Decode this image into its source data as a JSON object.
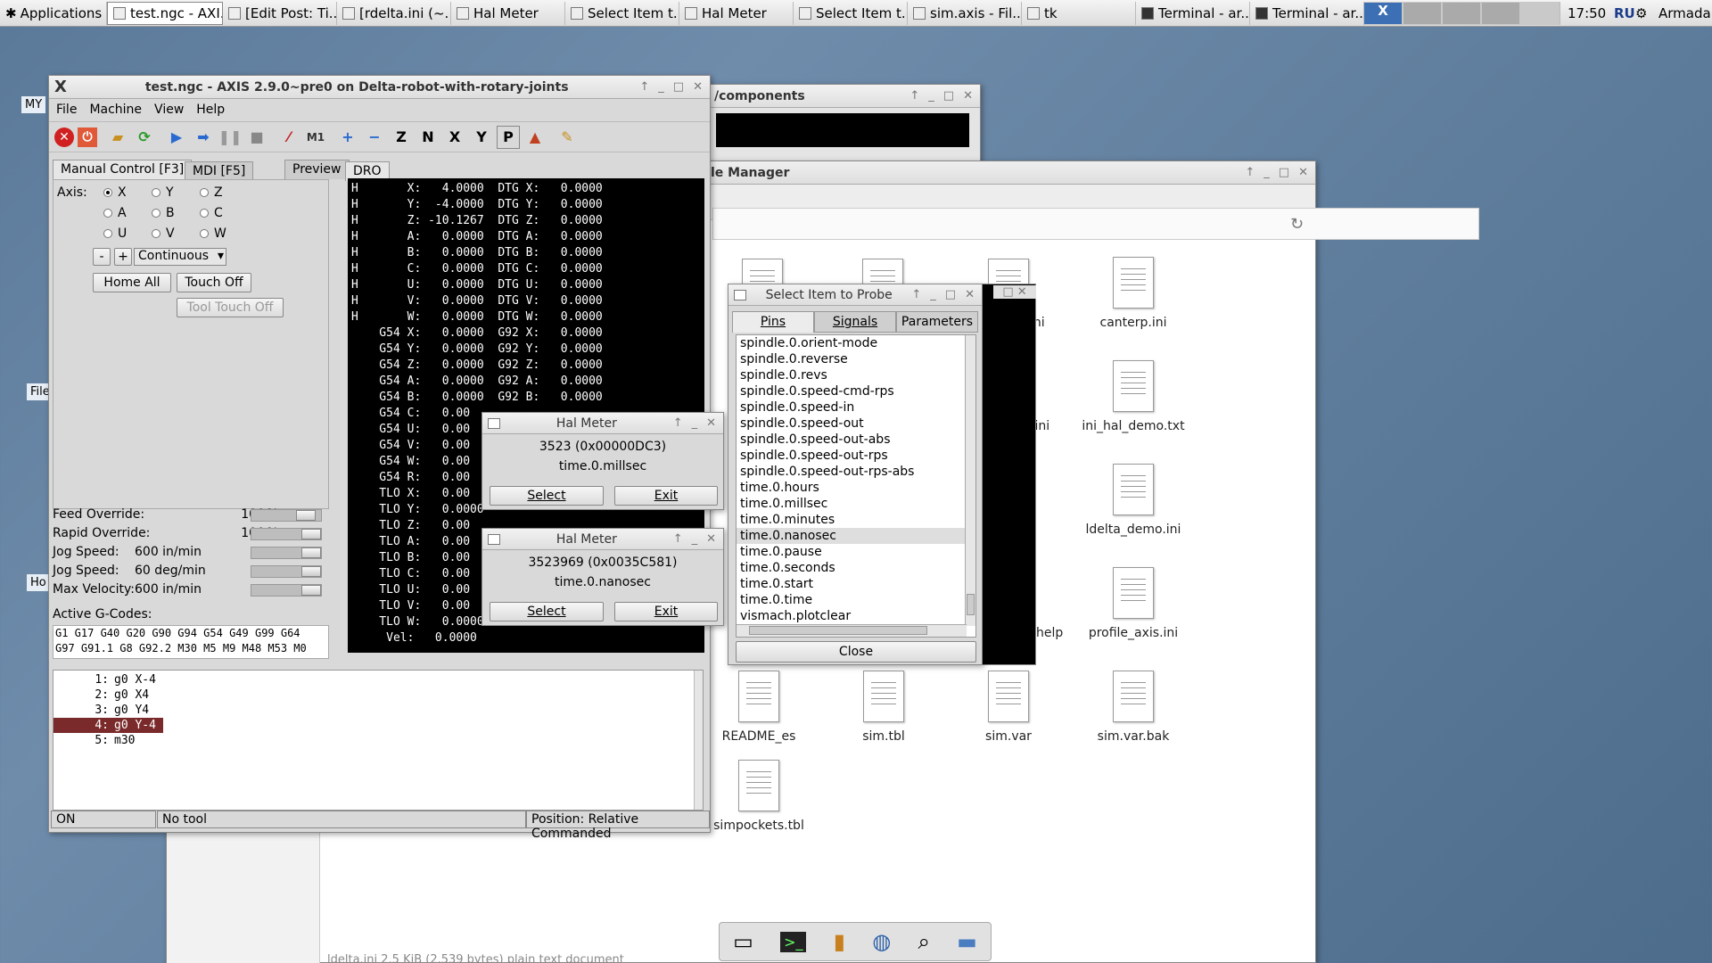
{
  "taskbar": {
    "apps": "Applications",
    "items": [
      "test.ngc - AXI...",
      "[Edit Post: Ti...",
      "[rdelta.ini (~...",
      "Hal Meter",
      "Select Item t...",
      "Hal Meter",
      "Select Item t...",
      "sim.axis - Fil...",
      "tk",
      "Terminal - ar...",
      "Terminal - ar..."
    ],
    "clock": "17:50",
    "lang": "RU",
    "user": "Armada"
  },
  "desktop": {
    "sidelabels": [
      "MY",
      "File",
      "Ho"
    ]
  },
  "components_window": {
    "title": "/components"
  },
  "file_manager": {
    "title": "le Manager",
    "files": [
      {
        "name": "canterp.ini"
      },
      {
        "name": "ini_hal_demo.txt"
      },
      {
        "name": "ldelta_demo.ini"
      },
      {
        "name": "profile_axis.ini"
      },
      {
        "name": "README_es"
      },
      {
        "name": "sim.tbl"
      },
      {
        "name": "sim.var"
      },
      {
        "name": "sim.var.bak"
      },
      {
        "name": "simpockets.tbl"
      }
    ],
    "partial": [
      "ini",
      ".ini",
      "help"
    ],
    "footer": "ldelta.ini 2.5 KiB (2,539 bytes) plain text document"
  },
  "axis": {
    "title": "test.ngc - AXIS 2.9.0~pre0 on Delta-robot-with-rotary-joints",
    "menu": [
      "File",
      "Machine",
      "View",
      "Help"
    ],
    "tabs_left": [
      "Manual Control [F3]",
      "MDI [F5]"
    ],
    "tabs_right": [
      "Preview",
      "DRO"
    ],
    "axis_label": "Axis:",
    "axes": [
      "X",
      "Y",
      "Z",
      "A",
      "B",
      "C",
      "U",
      "V",
      "W"
    ],
    "selected_axis": "X",
    "jog_minus": "-",
    "jog_plus": "+",
    "jog_mode": "Continuous",
    "home_all": "Home All",
    "touch_off": "Touch Off",
    "tool_touch_off": "Tool Touch Off",
    "overrides": [
      {
        "label": "Feed Override:",
        "value": "100",
        "unit": "%",
        "level": 0.9
      },
      {
        "label": "Rapid Override:",
        "value": "100",
        "unit": "%",
        "level": 1.0
      },
      {
        "label": "Jog Speed:",
        "value": "600 in/min",
        "unit": "",
        "level": 1.0
      },
      {
        "label": "Jog Speed:",
        "value": "60 deg/min",
        "unit": "",
        "level": 1.0
      },
      {
        "label": "Max Velocity:",
        "value": "600 in/min",
        "unit": "",
        "level": 1.0
      }
    ],
    "active_gcodes_label": "Active G-Codes:",
    "gcodes": [
      "G1 G17 G40 G20 G90 G94 G54 G49 G99 G64",
      "G97 G91.1 G8 G92.2 M30 M5 M9 M48 M53 M0"
    ],
    "dro": [
      "H       X:   4.0000  DTG X:   0.0000",
      "H       Y:  -4.0000  DTG Y:   0.0000",
      "H       Z: -10.1267  DTG Z:   0.0000",
      "H       A:   0.0000  DTG A:   0.0000",
      "H       B:   0.0000  DTG B:   0.0000",
      "H       C:   0.0000  DTG C:   0.0000",
      "H       U:   0.0000  DTG U:   0.0000",
      "H       V:   0.0000  DTG V:   0.0000",
      "H       W:   0.0000  DTG W:   0.0000",
      "    G54 X:   0.0000  G92 X:   0.0000",
      "    G54 Y:   0.0000  G92 Y:   0.0000",
      "    G54 Z:   0.0000  G92 Z:   0.0000",
      "    G54 A:   0.0000  G92 A:   0.0000",
      "    G54 B:   0.0000  G92 B:   0.0000",
      "    G54 C:   0.00",
      "    G54 U:   0.00",
      "    G54 V:   0.00",
      "    G54 W:   0.00",
      "    G54 R:   0.00",
      "    TLO X:   0.00",
      "    TLO Y:   0.0000",
      "    TLO Z:   0.00",
      "    TLO A:   0.00",
      "    TLO B:   0.00",
      "    TLO C:   0.00",
      "    TLO U:   0.00",
      "    TLO V:   0.00",
      "    TLO W:   0.0000",
      "     Vel:   0.0000"
    ],
    "program": [
      {
        "n": "1:",
        "code": "g0 X-4"
      },
      {
        "n": "2:",
        "code": "g0 X4"
      },
      {
        "n": "3:",
        "code": "g0 Y4"
      },
      {
        "n": "4:",
        "code": "g0 Y-4"
      },
      {
        "n": "5:",
        "code": "m30"
      }
    ],
    "current_line": 4,
    "status": {
      "state": "ON",
      "tool": "No tool",
      "position": "Position: Relative Commanded"
    }
  },
  "halmeter1": {
    "title": "Hal Meter",
    "value": "3523 (0x00000DC3)",
    "pin": "time.0.millsec",
    "select": "Select",
    "exit": "Exit"
  },
  "halmeter2": {
    "title": "Hal Meter",
    "value": "3523969 (0x0035C581)",
    "pin": "time.0.nanosec",
    "select": "Select",
    "exit": "Exit"
  },
  "probe": {
    "title": "Select Item to Probe",
    "tabs": [
      "Pins",
      "Signals",
      "Parameters"
    ],
    "items": [
      "spindle.0.orient-mode",
      "spindle.0.reverse",
      "spindle.0.revs",
      "spindle.0.speed-cmd-rps",
      "spindle.0.speed-in",
      "spindle.0.speed-out",
      "spindle.0.speed-out-abs",
      "spindle.0.speed-out-rps",
      "spindle.0.speed-out-rps-abs",
      "time.0.hours",
      "time.0.millsec",
      "time.0.minutes",
      "time.0.nanosec",
      "time.0.pause",
      "time.0.seconds",
      "time.0.start",
      "time.0.time",
      "vismach.plotclear"
    ],
    "selected": "time.0.nanosec",
    "close": "Close"
  },
  "dock": [
    "drive-icon",
    "terminal-icon",
    "archive-icon",
    "globe-icon",
    "search-icon",
    "folder-icon"
  ]
}
